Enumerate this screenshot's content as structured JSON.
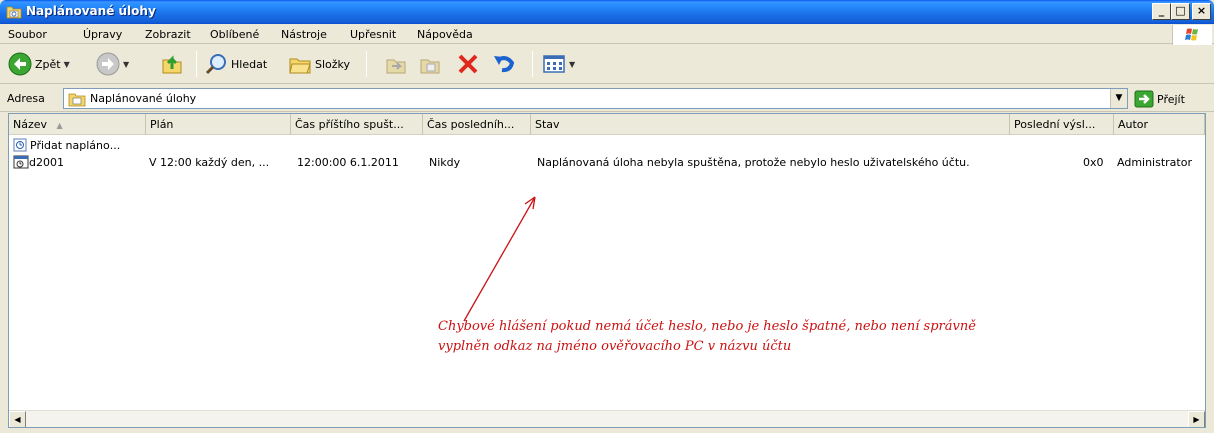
{
  "window": {
    "title": "Naplánované úlohy"
  },
  "menu": {
    "items": [
      "Soubor",
      "Úpravy",
      "Zobrazit",
      "Oblíbené",
      "Nástroje",
      "Upřesnit",
      "Nápověda"
    ]
  },
  "toolbar": {
    "back_label": "Zpět",
    "search_label": "Hledat",
    "folders_label": "Složky"
  },
  "address": {
    "label": "Adresa",
    "value": "Naplánované úlohy",
    "go_label": "Přejít"
  },
  "list": {
    "columns": [
      "Název",
      "Plán",
      "Čas příštího spušt...",
      "Čas posledníh...",
      "Stav",
      "Poslední výsl...",
      "Autor"
    ],
    "add_task_label": "Přidat naplánо...",
    "rows": [
      {
        "name": "d2001",
        "schedule": "V 12:00 každý den, ...",
        "next_run": "12:00:00  6.1.2011",
        "last_run": "Nikdy",
        "status": "Naplánovaná úloha nebyla spuštěna, protože nebylo heslo uživatelského účtu.",
        "last_result": "0x0",
        "author": "Administrator"
      }
    ]
  },
  "annotation": {
    "text_line1": "Chybové hlášení pokud nemá účet heslo, nebo je heslo špatné, nebo není správně",
    "text_line2": "vyplněn odkaz na jméno ověřovacího PC v názvu účtu",
    "color": "#CC1111"
  }
}
